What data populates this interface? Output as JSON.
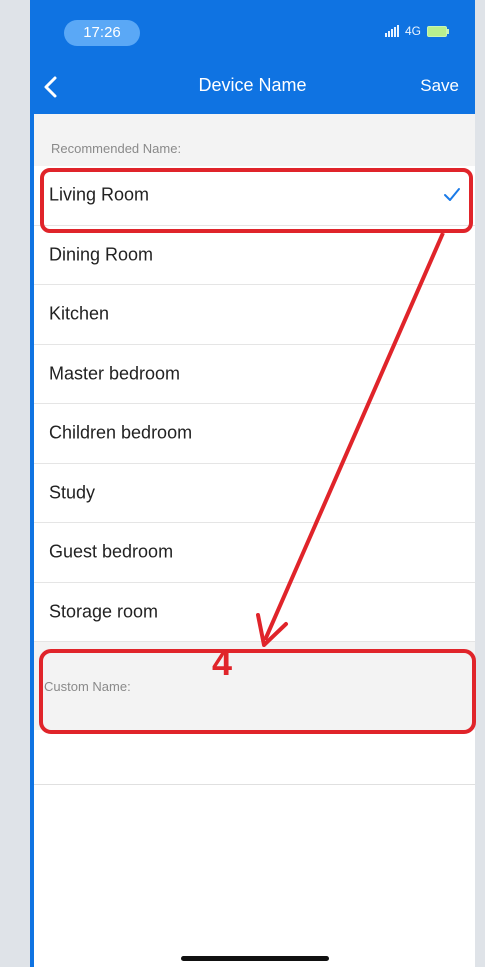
{
  "status_bar": {
    "time": "17:26",
    "network": "4G"
  },
  "header": {
    "title": "Device Name",
    "save_label": "Save"
  },
  "recommended": {
    "label": "Recommended Name:",
    "items": [
      {
        "label": "Living Room",
        "selected": true
      },
      {
        "label": "Dining Room"
      },
      {
        "label": "Kitchen"
      },
      {
        "label": "Master bedroom"
      },
      {
        "label": "Children bedroom"
      },
      {
        "label": "Study"
      },
      {
        "label": "Guest bedroom"
      },
      {
        "label": "Storage room"
      }
    ]
  },
  "custom": {
    "label": "Custom Name:",
    "value": ""
  },
  "annotation": {
    "step_number": "4",
    "color": "#e0242a"
  },
  "colors": {
    "header_blue": "#0f73e2",
    "checkmark_blue": "#1a7ae8",
    "section_gray": "#f3f3f3"
  }
}
